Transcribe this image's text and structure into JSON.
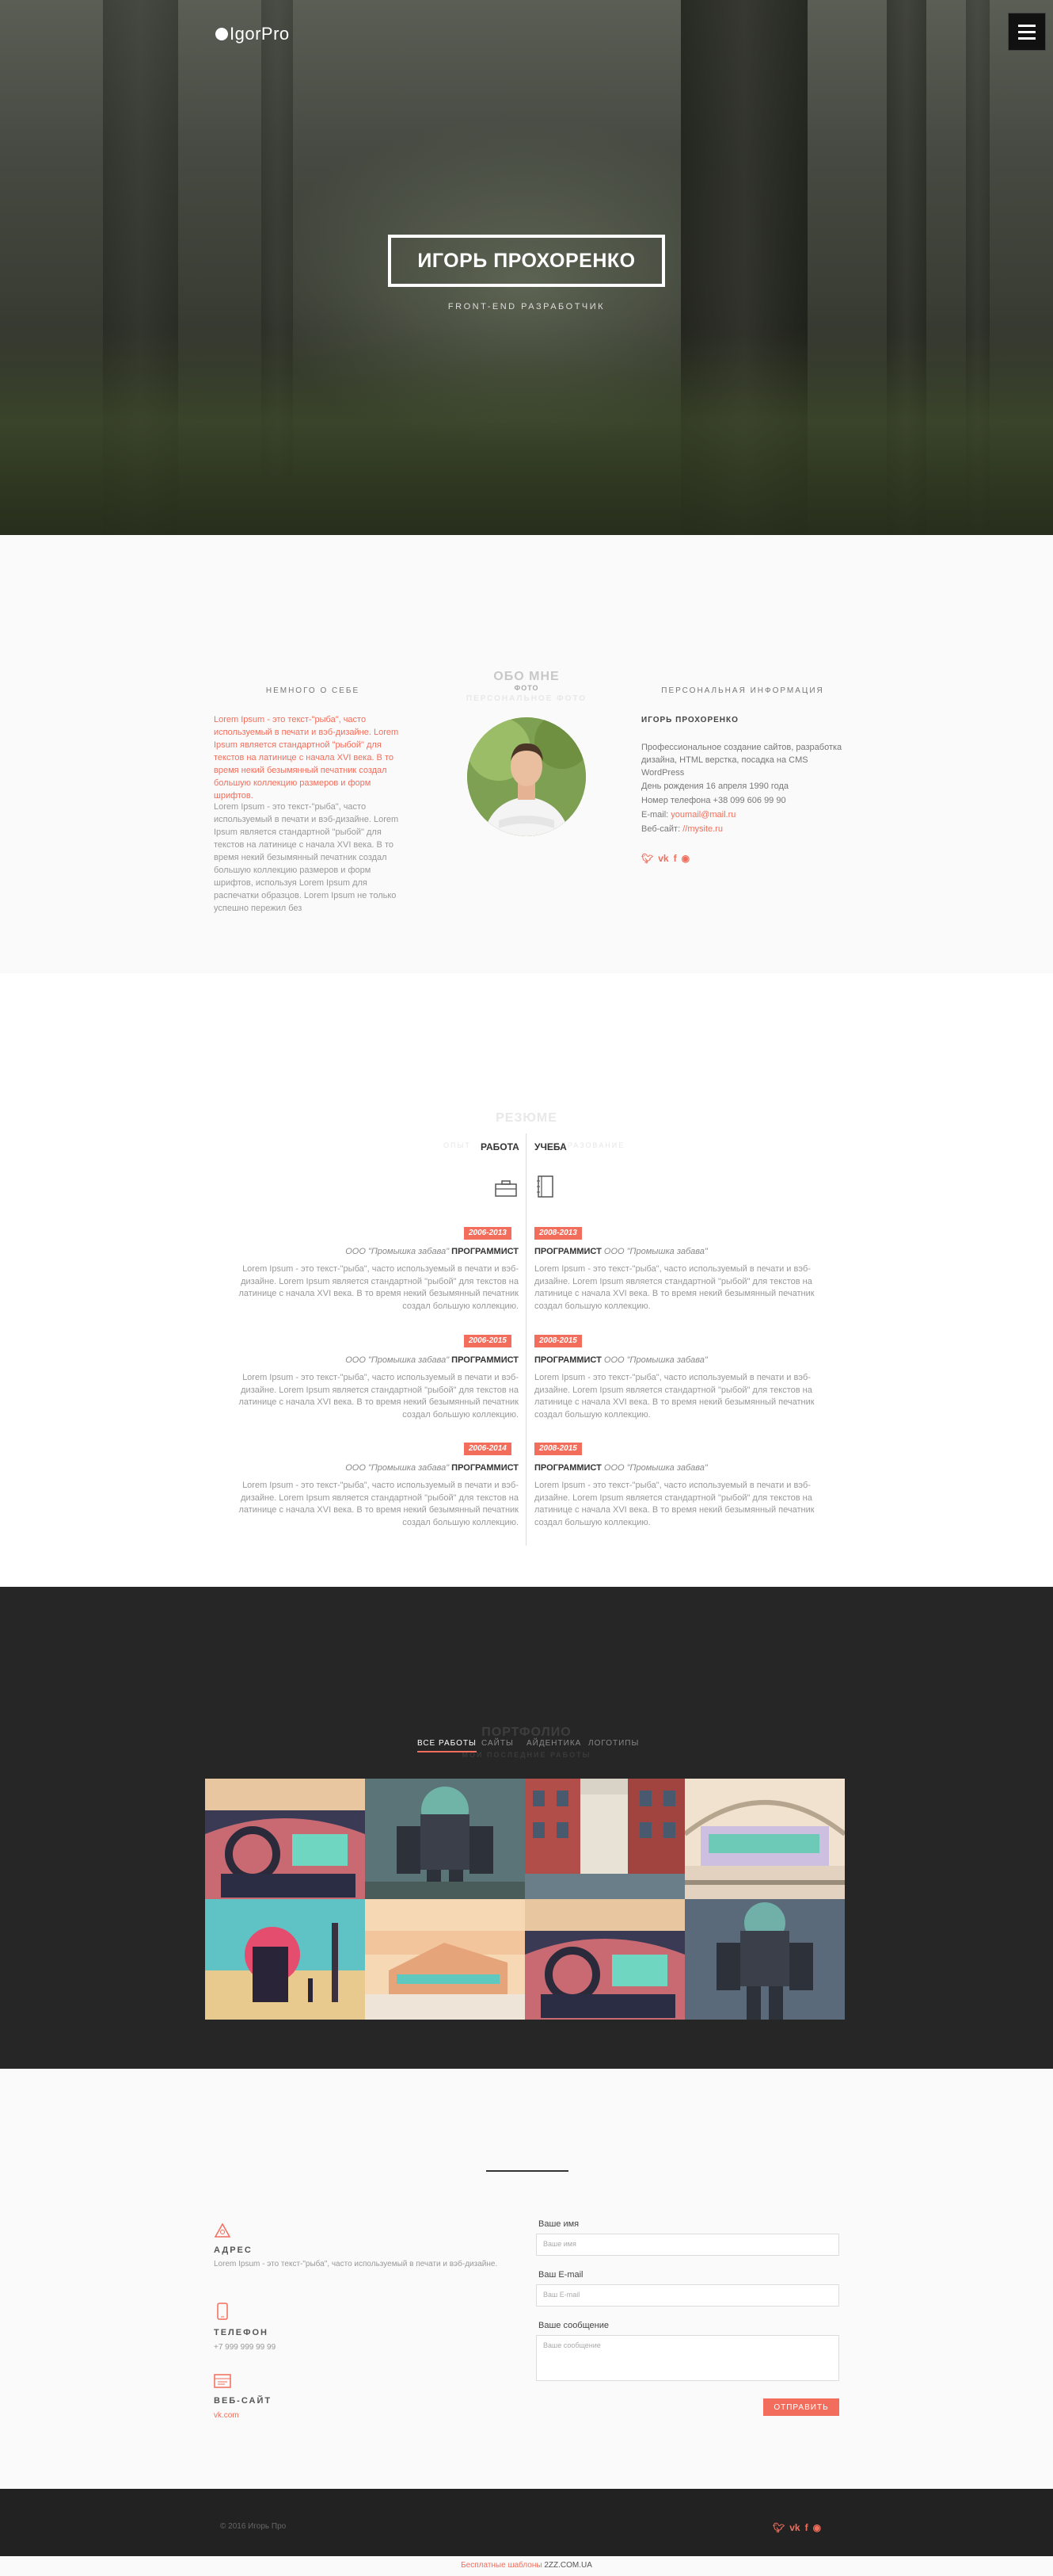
{
  "header": {
    "logo": "IgorPro"
  },
  "hero": {
    "name": "ИГОРЬ ПРОХОРЕНКО",
    "subtitle": "FRONT-END РАЗРАБОТЧИК"
  },
  "about": {
    "title": "ОБО МНЕ",
    "title_sub": "ФОТО",
    "title_ghost": "ПЕРСОНАЛЬНОЕ ФОТО",
    "left_heading": "НЕМНОГО О СЕБЕ",
    "left_orange": "Lorem Ipsum - это текст-\"рыба\", часто используемый в печати и вэб-дизайне. Lorem Ipsum является стандартной \"рыбой\" для текстов на латинице с начала XVI века. В то время некий безымянный печатник создал большую коллекцию размеров и форм шрифтов.",
    "left_grey": "Lorem Ipsum - это текст-\"рыба\", часто используемый в печати и вэб-дизайне. Lorem Ipsum является стандартной \"рыбой\" для текстов на латинице с начала XVI века. В то время некий безымянный печатник создал большую коллекцию размеров и форм шрифтов, используя Lorem Ipsum для распечатки образцов. Lorem Ipsum не только успешно пережил без",
    "right_heading": "ПЕРСОНАЛЬНАЯ ИНФОРМАЦИЯ",
    "right_name": "ИГОРЬ ПРОХОРЕНКО",
    "right_desc": "Профессиональное создание сайтов, разработка дизайна, HTML верстка, посадка на CMS WordPress",
    "birthday": "День рождения 16 апреля 1990 года",
    "phone": "Номер телефона +38 099 606 99 90",
    "email_label": "E-mail:",
    "email": "youmail@mail.ru",
    "site_label": "Веб-сайт:",
    "site": "//mysite.ru"
  },
  "resume": {
    "title": "РЕЗЮМЕ",
    "ghost_left": "ОПЫТ",
    "ghost_right": "ОБРАЗОВАНИЕ",
    "tab_work": "РАБОТА",
    "tab_study": "УЧЕБА",
    "work": [
      {
        "years": "2006-2013",
        "company": "ООО \"Промышка забава\"",
        "role": "ПРОГРАММИСТ",
        "text": "Lorem Ipsum - это текст-\"рыба\", часто используемый в печати и вэб-дизайне. Lorem Ipsum является стандартной \"рыбой\" для текстов на латинице с начала XVI века. В то время некий безымянный печатник создал большую коллекцию."
      },
      {
        "years": "2006-2015",
        "company": "ООО \"Промышка забава\"",
        "role": "ПРОГРАММИСТ",
        "text": "Lorem Ipsum - это текст-\"рыба\", часто используемый в печати и вэб-дизайне. Lorem Ipsum является стандартной \"рыбой\" для текстов на латинице с начала XVI века. В то время некий безымянный печатник создал большую коллекцию."
      },
      {
        "years": "2006-2014",
        "company": "ООО \"Промышка забава\"",
        "role": "ПРОГРАММИСТ",
        "text": "Lorem Ipsum - это текст-\"рыба\", часто используемый в печати и вэб-дизайне. Lorem Ipsum является стандартной \"рыбой\" для текстов на латинице с начала XVI века. В то время некий безымянный печатник создал большую коллекцию."
      }
    ],
    "study": [
      {
        "years": "2008-2013",
        "company": "ООО \"Промышка забава\"",
        "role": "ПРОГРАММИСТ",
        "text": "Lorem Ipsum - это текст-\"рыба\", часто используемый в печати и вэб-дизайне. Lorem Ipsum является стандартной \"рыбой\" для текстов на латинице с начала XVI века. В то время некий безымянный печатник создал большую коллекцию."
      },
      {
        "years": "2008-2015",
        "company": "ООО \"Промышка забава\"",
        "role": "ПРОГРАММИСТ",
        "text": "Lorem Ipsum - это текст-\"рыба\", часто используемый в печати и вэб-дизайне. Lorem Ipsum является стандартной \"рыбой\" для текстов на латинице с начала XVI века. В то время некий безымянный печатник создал большую коллекцию."
      },
      {
        "years": "2008-2015",
        "company": "ООО \"Промышка забава\"",
        "role": "ПРОГРАММИСТ",
        "text": "Lorem Ipsum - это текст-\"рыба\", часто используемый в печати и вэб-дизайне. Lorem Ipsum является стандартной \"рыбой\" для текстов на латинице с начала XVI века. В то время некий безымянный печатник создал большую коллекцию."
      }
    ]
  },
  "portfolio": {
    "title": "ПОРТФОЛИО",
    "ghost": "МОИ ПОСЛЕДНИЕ РАБОТЫ",
    "filters": [
      "ВСЕ РАБОТЫ",
      "САЙТЫ",
      "АЙДЕНТИКА",
      "ЛОГОТИПЫ"
    ]
  },
  "contacts": {
    "address_label": "АДРЕС",
    "address_text": "Lorem Ipsum - это текст-\"рыба\", часто используемый в печати и вэб-дизайне.",
    "phone_label": "ТЕЛЕФОН",
    "phone_text": "+7 999 999 99 99",
    "site_label": "ВЕБ-САЙТ",
    "site_text": "vk.com",
    "form": {
      "name_label": "Ваше имя",
      "name_placeholder": "Ваше имя",
      "email_label": "Ваш E-mail",
      "email_placeholder": "Ваш E-mail",
      "msg_label": "Ваше сообщение",
      "msg_placeholder": "Ваше сообщение",
      "send": "ОТПРАВИТЬ"
    }
  },
  "footer": {
    "copyright": "© 2016 Игорь Про",
    "credit_link": "Бесплатные шаблоны",
    "credit_site": "2ZZ.COM.UA"
  },
  "colors": {
    "accent": "#f26d5b",
    "dark": "#262626"
  }
}
